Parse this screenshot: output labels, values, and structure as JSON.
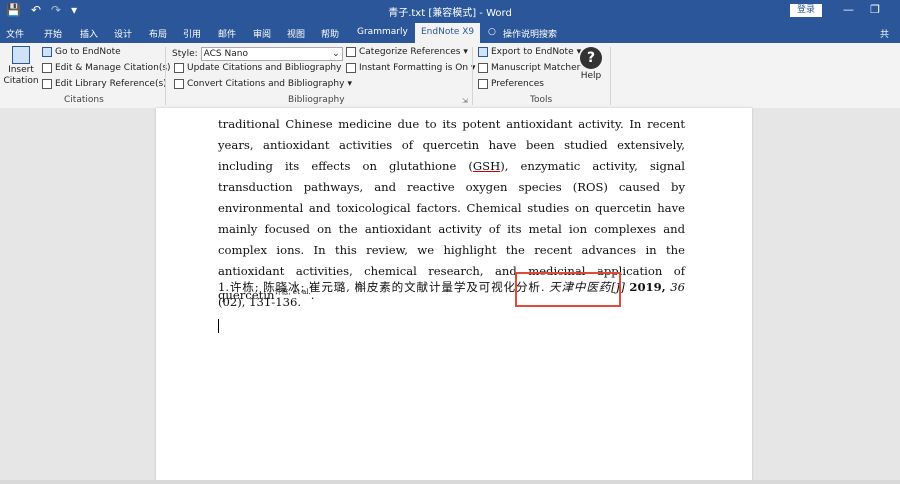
{
  "titlebar": {
    "title": "青子.txt [兼容模式] - Word",
    "login": "登录",
    "icons": [
      "save-icon",
      "undo-icon",
      "redo-icon",
      "customize-icon"
    ]
  },
  "tabs": [
    "文件",
    "开始",
    "插入",
    "设计",
    "布局",
    "引用",
    "邮件",
    "审阅",
    "视图",
    "帮助",
    "Grammarly",
    "EndNote X9",
    "操作说明搜索",
    "共"
  ],
  "ribbon": {
    "citations": {
      "insert_citation_l1": "Insert",
      "insert_citation_l2": "Citation",
      "go_to_endnote": "Go to EndNote",
      "edit_manage": "Edit & Manage Citation(s)",
      "edit_library": "Edit Library Reference(s)",
      "group": "Citations"
    },
    "bibliography": {
      "style_label": "Style:",
      "style_value": "ACS Nano",
      "update": "Update Citations and Bibliography",
      "convert": "Convert Citations and Bibliography",
      "categorize": "Categorize References",
      "instant": "Instant Formatting is On",
      "group": "Bibliography"
    },
    "tools": {
      "export": "Export to EndNote",
      "manuscript": "Manuscript Matcher",
      "preferences": "Preferences",
      "help": "Help",
      "group": "Tools"
    }
  },
  "document": {
    "para_a": "traditional Chinese medicine due to its potent antioxidant activity. In recent years, antioxidant activities of quercetin have been studied extensively, including its effects on glutathione (",
    "para_gsh": "GSH",
    "para_b": "), enzymatic activity, signal transduction pathways, and reactive oxygen species (ROS) caused by environmental and toxicological factors. Chemical studies on quercetin have mainly focused on the antioxidant activity of its metal ion complexes and complex ions. In this review, we highlight the recent advances in the antioxidant activities, chemical research, and medicinal application of quercetin",
    "para_sup": "许栋, et al.",
    "para_end": ".",
    "ref_num": "1.",
    "ref_authors": "许栋; 陈晓冰; 崔元璐, 槲皮素的文献计量学及可视化分析.",
    "ref_journal": "天津中医药[J]",
    "ref_year": "2019,",
    "ref_vol": "36",
    "ref_rest": "(02), 131-136."
  }
}
